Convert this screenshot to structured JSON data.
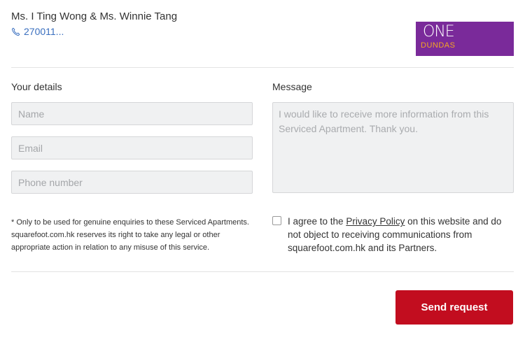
{
  "agent": {
    "name": "Ms. I Ting Wong & Ms. Winnie Tang",
    "phone": "270011..."
  },
  "logo": {
    "line1": "ONE",
    "line2": "DUNDAS",
    "bg_color": "#7a2a9a",
    "accent_color": "#f5a623"
  },
  "form": {
    "details_heading": "Your details",
    "message_heading": "Message",
    "name_placeholder": "Name",
    "email_placeholder": "Email",
    "phone_placeholder": "Phone number",
    "message_placeholder": "I would like to receive more information from this Serviced Apartment. Thank you.",
    "disclaimer": "* Only to be used for genuine enquiries to these Serviced Apartments. squarefoot.com.hk reserves its right to take any legal or other appropriate action in relation to any misuse of this service.",
    "consent_prefix": "I agree to the ",
    "consent_link": "Privacy Policy",
    "consent_suffix": " on this website and do not object to receiving communications from squarefoot.com.hk and its Partners.",
    "consent_checked": false,
    "submit_label": "Send request",
    "submit_color": "#c20d1f"
  }
}
